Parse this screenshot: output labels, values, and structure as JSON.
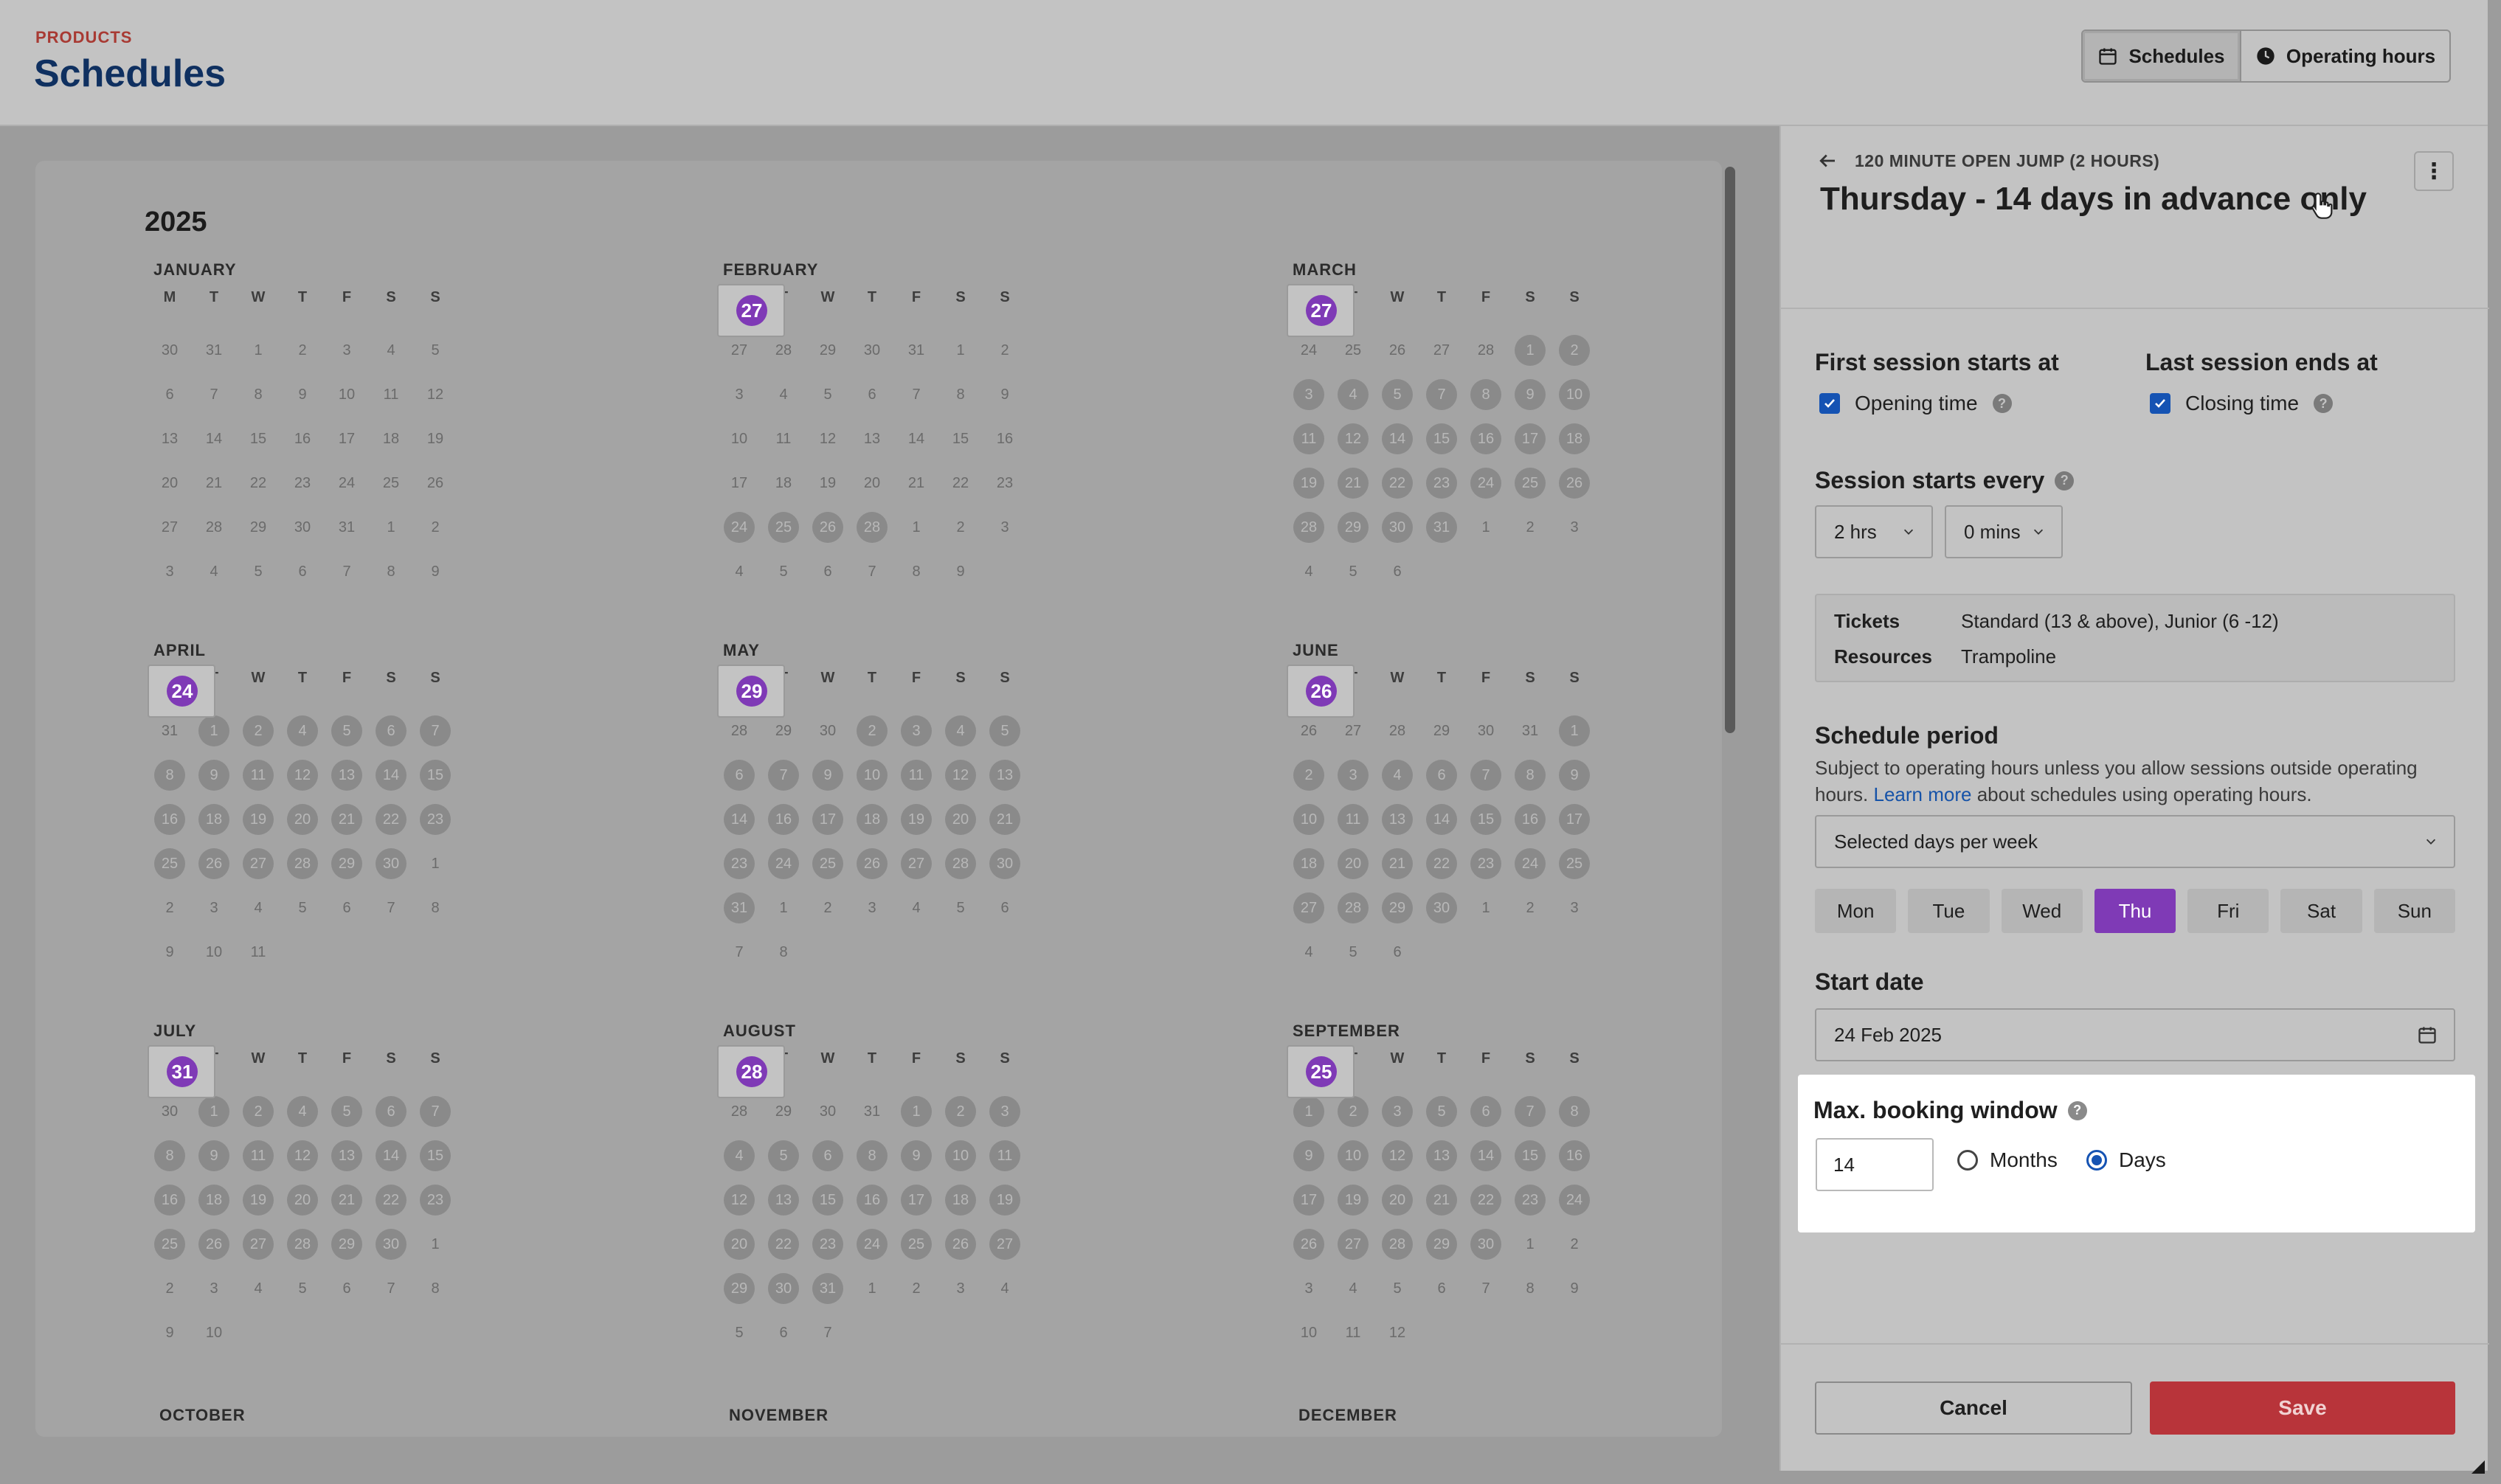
{
  "header": {
    "eyebrow": "PRODUCTS",
    "title": "Schedules",
    "views": [
      {
        "label": "Schedules",
        "icon": "calendar-icon",
        "active": true
      },
      {
        "label": "Operating hours",
        "icon": "clock-icon",
        "active": false
      }
    ]
  },
  "calendar": {
    "year": "2025",
    "weekday_headers": [
      "M",
      "T",
      "W",
      "T",
      "F",
      "S",
      "S"
    ],
    "months": [
      {
        "name": "JANUARY",
        "days": [
          "30",
          "31",
          "1",
          "2",
          "3",
          "4",
          "5",
          "6",
          "7",
          "8",
          "9",
          "10",
          "11",
          "12",
          "13",
          "14",
          "15",
          "16",
          "17",
          "18",
          "19",
          "20",
          "21",
          "22",
          "23",
          "24",
          "25",
          "26",
          "27",
          "28",
          "29",
          "30",
          "31",
          "1",
          "2",
          "3",
          "4",
          "5",
          "6",
          "7",
          "8",
          "9"
        ],
        "first_in": 2,
        "last_in": 32,
        "available_from": null,
        "selected": []
      },
      {
        "name": "FEBRUARY",
        "days": [
          "27",
          "28",
          "29",
          "30",
          "31",
          "1",
          "2",
          "3",
          "4",
          "5",
          "6",
          "7",
          "8",
          "9",
          "10",
          "11",
          "12",
          "13",
          "14",
          "15",
          "16",
          "17",
          "18",
          "19",
          "20",
          "21",
          "22",
          "23",
          "24",
          "25",
          "26",
          "27",
          "28",
          "1",
          "2",
          "3",
          "4",
          "5",
          "6",
          "7",
          "8",
          "9"
        ],
        "first_in": 5,
        "last_in": 32,
        "available_from": 28,
        "selected": [
          31
        ]
      },
      {
        "name": "MARCH",
        "days": [
          "24",
          "25",
          "26",
          "27",
          "28",
          "1",
          "2",
          "3",
          "4",
          "5",
          "6",
          "7",
          "8",
          "9",
          "10",
          "11",
          "12",
          "13",
          "14",
          "15",
          "16",
          "17",
          "18",
          "19",
          "20",
          "21",
          "22",
          "23",
          "24",
          "25",
          "26",
          "27",
          "28",
          "29",
          "30",
          "31",
          "1",
          "2",
          "3",
          "4",
          "5",
          "6"
        ],
        "first_in": 5,
        "last_in": 35,
        "available_from": 5,
        "selected": [
          10,
          17,
          24,
          31
        ]
      },
      {
        "name": "APRIL",
        "days": [
          "31",
          "1",
          "2",
          "3",
          "4",
          "5",
          "6",
          "7",
          "8",
          "9",
          "10",
          "11",
          "12",
          "13",
          "14",
          "15",
          "16",
          "17",
          "18",
          "19",
          "20",
          "21",
          "22",
          "23",
          "24",
          "25",
          "26",
          "27",
          "28",
          "29",
          "30",
          "1",
          "2",
          "3",
          "4",
          "5",
          "6",
          "7",
          "8",
          "9",
          "10",
          "11"
        ],
        "first_in": 1,
        "last_in": 30,
        "available_from": 1,
        "selected": [
          3,
          10,
          17,
          24
        ]
      },
      {
        "name": "MAY",
        "days": [
          "28",
          "29",
          "30",
          "1",
          "2",
          "3",
          "4",
          "5",
          "6",
          "7",
          "8",
          "9",
          "10",
          "11",
          "12",
          "13",
          "14",
          "15",
          "16",
          "17",
          "18",
          "19",
          "20",
          "21",
          "22",
          "23",
          "24",
          "25",
          "26",
          "27",
          "28",
          "29",
          "30",
          "31",
          "1",
          "2",
          "3",
          "4",
          "5",
          "6",
          "7",
          "8"
        ],
        "first_in": 3,
        "last_in": 33,
        "available_from": 3,
        "selected": [
          3,
          10,
          17,
          24,
          31
        ]
      },
      {
        "name": "JUNE",
        "days": [
          "26",
          "27",
          "28",
          "29",
          "30",
          "31",
          "1",
          "2",
          "3",
          "4",
          "5",
          "6",
          "7",
          "8",
          "9",
          "10",
          "11",
          "12",
          "13",
          "14",
          "15",
          "16",
          "17",
          "18",
          "19",
          "20",
          "21",
          "22",
          "23",
          "24",
          "25",
          "26",
          "27",
          "28",
          "29",
          "30",
          "1",
          "2",
          "3",
          "4",
          "5",
          "6"
        ],
        "first_in": 6,
        "last_in": 35,
        "available_from": 6,
        "selected": [
          10,
          17,
          24,
          31
        ]
      },
      {
        "name": "JULY",
        "days": [
          "30",
          "1",
          "2",
          "3",
          "4",
          "5",
          "6",
          "7",
          "8",
          "9",
          "10",
          "11",
          "12",
          "13",
          "14",
          "15",
          "16",
          "17",
          "18",
          "19",
          "20",
          "21",
          "22",
          "23",
          "24",
          "25",
          "26",
          "27",
          "28",
          "29",
          "30",
          "31",
          "1",
          "2",
          "3",
          "4",
          "5",
          "6",
          "7",
          "8",
          "9",
          "10"
        ],
        "first_in": 1,
        "last_in": 31,
        "available_from": 1,
        "selected": [
          3,
          10,
          17,
          24,
          31
        ]
      },
      {
        "name": "AUGUST",
        "days": [
          "28",
          "29",
          "30",
          "31",
          "1",
          "2",
          "3",
          "4",
          "5",
          "6",
          "7",
          "8",
          "9",
          "10",
          "11",
          "12",
          "13",
          "14",
          "15",
          "16",
          "17",
          "18",
          "19",
          "20",
          "21",
          "22",
          "23",
          "24",
          "25",
          "26",
          "27",
          "28",
          "29",
          "30",
          "31",
          "1",
          "2",
          "3",
          "4",
          "5",
          "6",
          "7"
        ],
        "first_in": 4,
        "last_in": 34,
        "available_from": 4,
        "selected": [
          10,
          17,
          24,
          31
        ]
      },
      {
        "name": "SEPTEMBER",
        "days": [
          "1",
          "2",
          "3",
          "4",
          "5",
          "6",
          "7",
          "8",
          "9",
          "10",
          "11",
          "12",
          "13",
          "14",
          "15",
          "16",
          "17",
          "18",
          "19",
          "20",
          "21",
          "22",
          "23",
          "24",
          "25",
          "26",
          "27",
          "28",
          "29",
          "30",
          "1",
          "2",
          "3",
          "4",
          "5",
          "6",
          "7",
          "8",
          "9",
          "10",
          "11",
          "12"
        ],
        "first_in": 0,
        "last_in": 29,
        "available_from": 0,
        "selected": [
          3,
          10,
          17,
          24
        ]
      }
    ],
    "next_months": [
      "OCTOBER",
      "NOVEMBER",
      "DECEMBER"
    ]
  },
  "panel": {
    "breadcrumb": "120 MINUTE OPEN JUMP (2 HOURS)",
    "title": "Thursday - 14 days in advance only",
    "menu_glyph": "⋮",
    "first_session_heading": "First session starts at",
    "first_session_option": "Opening time",
    "last_session_heading": "Last session ends at",
    "last_session_option": "Closing time",
    "interval_heading": "Session starts every",
    "interval_hours": "2 hrs",
    "interval_mins": "0 mins",
    "tickets_label": "Tickets",
    "tickets_value": "Standard (13 & above), Junior (6 -12)",
    "resources_label": "Resources",
    "resources_value": "Trampoline",
    "period_heading": "Schedule period",
    "period_help_a": "Subject to operating hours unless you allow sessions outside operating hours.",
    "period_help_link": "Learn more",
    "period_help_b": "about schedules using operating hours.",
    "period_mode": "Selected days per week",
    "weekdays": [
      {
        "label": "Mon",
        "on": false
      },
      {
        "label": "Tue",
        "on": false
      },
      {
        "label": "Wed",
        "on": false
      },
      {
        "label": "Thu",
        "on": true
      },
      {
        "label": "Fri",
        "on": false
      },
      {
        "label": "Sat",
        "on": false
      },
      {
        "label": "Sun",
        "on": false
      }
    ],
    "start_date_heading": "Start date",
    "start_date_value": "24 Feb 2025",
    "booking_window_heading": "Max. booking window",
    "booking_window_value": "14",
    "unit_months": "Months",
    "unit_days": "Days",
    "unit_selected": "Days",
    "cancel_label": "Cancel",
    "save_label": "Save"
  }
}
